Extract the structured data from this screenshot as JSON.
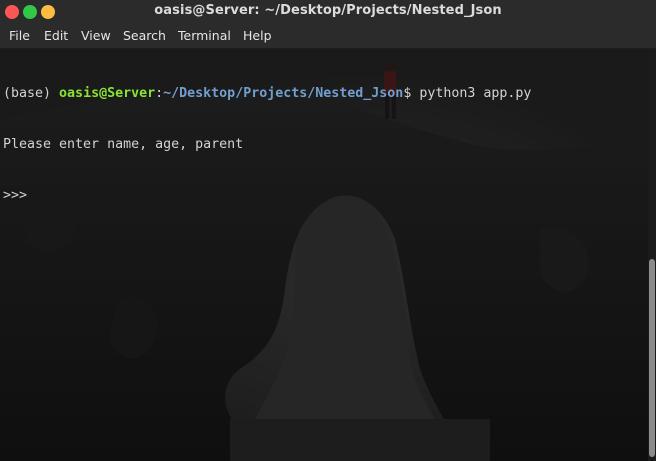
{
  "window": {
    "title": "oasis@Server: ~/Desktop/Projects/Nested_Json"
  },
  "menu": {
    "items": [
      "File",
      "Edit",
      "View",
      "Search",
      "Terminal",
      "Help"
    ]
  },
  "terminal": {
    "prompt": {
      "env": "(base) ",
      "user_host": "oasis@Server",
      "sep": ":",
      "path": "~/Desktop/Projects/Nested_Json",
      "symbol": "$ ",
      "command": "python3 app.py"
    },
    "output_lines": [
      "Please enter name, age, parent",
      ">>>"
    ],
    "colors": {
      "user_host": "#8ae234",
      "path": "#729fcf",
      "text": "#d3d3d3",
      "background": "#151515"
    }
  },
  "scrollbar": {
    "position_fraction": 0.51,
    "visible_fraction": 0.48
  },
  "titlebar_buttons": {
    "close": "#fc5753",
    "minimize": "#33c748",
    "maximize": "#fdbc40"
  }
}
